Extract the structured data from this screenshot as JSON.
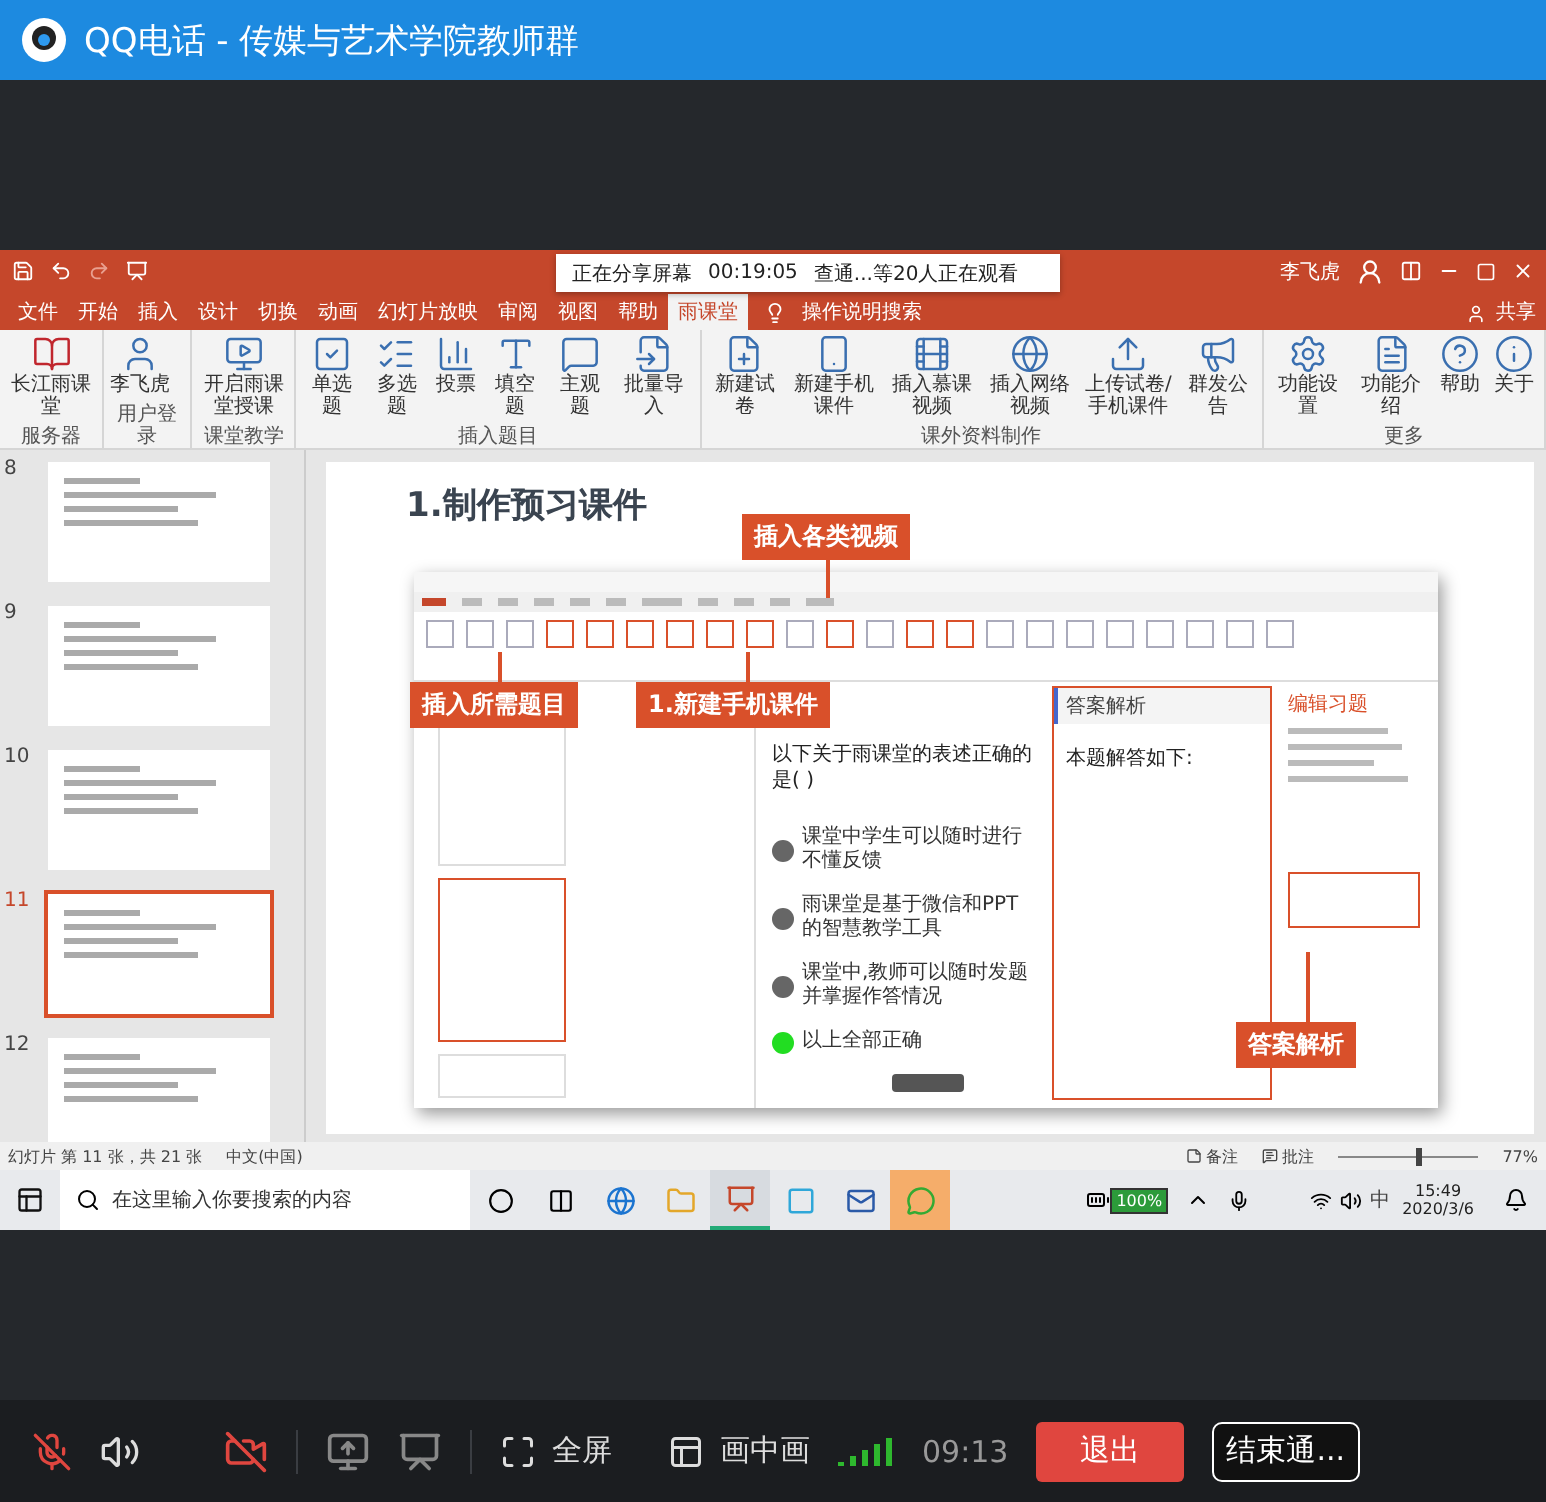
{
  "window": {
    "title": "QQ电话 - 传媒与艺术学院教师群"
  },
  "share_notice": {
    "status": "正在分享屏幕",
    "duration": "00:19:05",
    "viewers": "查通...等20人正在观看"
  },
  "ppt": {
    "user": "李飞虎",
    "search": "操作说明搜索",
    "share": "共享",
    "tabs": [
      {
        "label": "文件",
        "selected": false
      },
      {
        "label": "开始",
        "selected": false
      },
      {
        "label": "插入",
        "selected": false
      },
      {
        "label": "设计",
        "selected": false
      },
      {
        "label": "切换",
        "selected": false
      },
      {
        "label": "动画",
        "selected": false
      },
      {
        "label": "幻灯片放映",
        "selected": false
      },
      {
        "label": "审阅",
        "selected": false
      },
      {
        "label": "视图",
        "selected": false
      },
      {
        "label": "帮助",
        "selected": false
      },
      {
        "label": "雨课堂",
        "selected": true
      }
    ],
    "ribbon": [
      {
        "group": "服务器",
        "buttons": [
          "长江雨课堂"
        ]
      },
      {
        "group": "用户登录",
        "buttons": [
          "李飞虎"
        ]
      },
      {
        "group": "课堂教学",
        "buttons": [
          "开启雨课堂授课"
        ]
      },
      {
        "group": "插入题目",
        "buttons": [
          "单选题",
          "多选题",
          "投票",
          "填空题",
          "主观题",
          "批量导入"
        ]
      },
      {
        "group": "课外资料制作",
        "buttons": [
          "新建试卷",
          "新建手机课件",
          "插入慕课视频",
          "插入网络视频",
          "上传试卷/手机课件",
          "群发公告"
        ]
      },
      {
        "group": "更多",
        "buttons": [
          "功能设置",
          "功能介绍",
          "帮助",
          "关于"
        ]
      }
    ],
    "thumbnails": [
      {
        "number": "8",
        "selected": false
      },
      {
        "number": "9",
        "selected": false
      },
      {
        "number": "10",
        "selected": false
      },
      {
        "number": "11",
        "selected": true
      },
      {
        "number": "12",
        "selected": false
      }
    ],
    "slide": {
      "title": "1.制作预习课件",
      "callouts": [
        "插入各类视频",
        "插入所需题目",
        "1.新建手机课件",
        "答案解析"
      ],
      "question": "以下关于雨课堂的表述正确的是(    )",
      "options": [
        {
          "text": "课堂中学生可以随时进行不懂反馈",
          "selected": false
        },
        {
          "text": "雨课堂是基于微信和PPT的智慧教学工具",
          "selected": false
        },
        {
          "text": "课堂中,教师可以随时发题并掌握作答情况",
          "selected": false
        },
        {
          "text": "以上全部正确",
          "selected": true
        }
      ],
      "answer_header": "答案解析",
      "answer_body": "本题解答如下:",
      "editor_title": "编辑习题"
    },
    "status_bar": {
      "slide_info": "幻灯片 第 11 张，共 21 张",
      "language": "中文(中国)",
      "notes": "备注",
      "comments": "批注",
      "zoom": "77%",
      "level": 0.55
    },
    "taskbar": {
      "placeholder": "在这里输入你要搜索的内容",
      "battery": "100%",
      "ime": "中",
      "time": "15:49",
      "date": "2020/3/6"
    }
  },
  "call_bar": {
    "mic_muted": true,
    "camera_on": false,
    "fullscreen": "全屏",
    "pip": "画中画",
    "timer": "09:13",
    "exit": "退出",
    "end": "结束通..."
  }
}
